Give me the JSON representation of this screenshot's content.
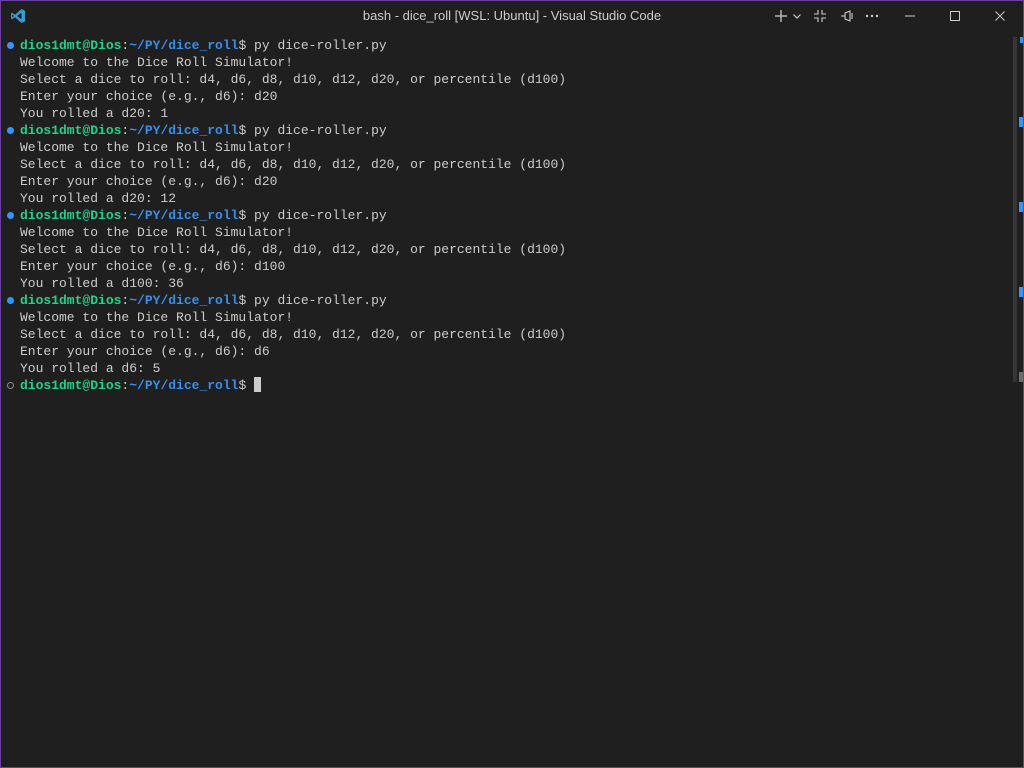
{
  "window": {
    "title": "bash - dice_roll [WSL: Ubuntu] - Visual Studio Code",
    "accent_border": "#6b3fa0"
  },
  "title_actions": [
    {
      "name": "new-terminal-plus-icon"
    },
    {
      "name": "chevron-down-icon"
    },
    {
      "name": "layout-toggle-icon"
    },
    {
      "name": "pin-icon"
    },
    {
      "name": "more-actions-icon"
    },
    {
      "name": "minimize-icon"
    },
    {
      "name": "maximize-icon"
    },
    {
      "name": "close-icon"
    }
  ],
  "terminal": {
    "colors": {
      "user": "#23d18b",
      "path": "#3b8eea",
      "text": "#cccccc",
      "decoration": "#3794ff"
    },
    "lines": [
      {
        "kind": "prompt",
        "deco": "success",
        "user": "dios1dmt@Dios",
        "sep": ":",
        "path": "~/PY/dice_roll",
        "cmd": "$ py dice-roller.py"
      },
      {
        "kind": "output",
        "text": "Welcome to the Dice Roll Simulator!"
      },
      {
        "kind": "output",
        "text": "Select a dice to roll: d4, d6, d8, d10, d12, d20, or percentile (d100)"
      },
      {
        "kind": "output",
        "text": "Enter your choice (e.g., d6): d20"
      },
      {
        "kind": "output",
        "text": "You rolled a d20: 1"
      },
      {
        "kind": "prompt",
        "deco": "success",
        "user": "dios1dmt@Dios",
        "sep": ":",
        "path": "~/PY/dice_roll",
        "cmd": "$ py dice-roller.py"
      },
      {
        "kind": "output",
        "text": "Welcome to the Dice Roll Simulator!"
      },
      {
        "kind": "output",
        "text": "Select a dice to roll: d4, d6, d8, d10, d12, d20, or percentile (d100)"
      },
      {
        "kind": "output",
        "text": "Enter your choice (e.g., d6): d20"
      },
      {
        "kind": "output",
        "text": "You rolled a d20: 12"
      },
      {
        "kind": "prompt",
        "deco": "success",
        "user": "dios1dmt@Dios",
        "sep": ":",
        "path": "~/PY/dice_roll",
        "cmd": "$ py dice-roller.py"
      },
      {
        "kind": "output",
        "text": "Welcome to the Dice Roll Simulator!"
      },
      {
        "kind": "output",
        "text": "Select a dice to roll: d4, d6, d8, d10, d12, d20, or percentile (d100)"
      },
      {
        "kind": "output",
        "text": "Enter your choice (e.g., d6): d100"
      },
      {
        "kind": "output",
        "text": "You rolled a d100: 36"
      },
      {
        "kind": "prompt",
        "deco": "success",
        "user": "dios1dmt@Dios",
        "sep": ":",
        "path": "~/PY/dice_roll",
        "cmd": "$ py dice-roller.py"
      },
      {
        "kind": "output",
        "text": "Welcome to the Dice Roll Simulator!"
      },
      {
        "kind": "output",
        "text": "Select a dice to roll: d4, d6, d8, d10, d12, d20, or percentile (d100)"
      },
      {
        "kind": "output",
        "text": "Enter your choice (e.g., d6): d6"
      },
      {
        "kind": "output",
        "text": "You rolled a d6: 5"
      },
      {
        "kind": "prompt",
        "deco": "pending",
        "user": "dios1dmt@Dios",
        "sep": ":",
        "path": "~/PY/dice_roll",
        "cmd": "$ ",
        "cursor": true
      }
    ]
  }
}
